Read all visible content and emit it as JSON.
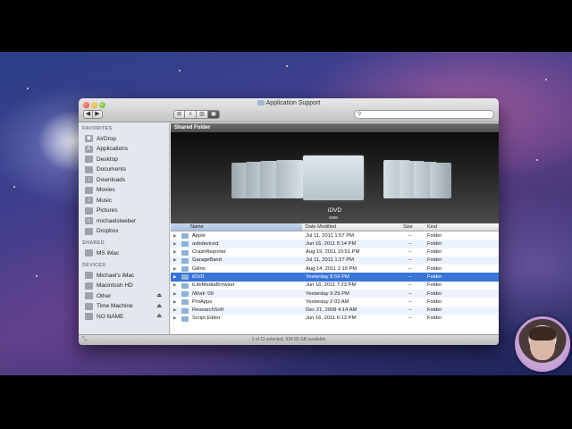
{
  "window": {
    "title": "Application Support",
    "nav": {
      "back": "◀",
      "forward": "▶"
    },
    "view_buttons": [
      "⊞",
      "≡",
      "▥",
      "▣"
    ],
    "search": {
      "placeholder": "",
      "icon": "magnifier-icon"
    }
  },
  "sidebar": {
    "favorites_head": "FAVORITES",
    "favorites": [
      {
        "label": "AirDrop",
        "icon": "airdrop-icon"
      },
      {
        "label": "Applications",
        "icon": "applications-icon"
      },
      {
        "label": "Desktop",
        "icon": "desktop-icon"
      },
      {
        "label": "Documents",
        "icon": "documents-icon"
      },
      {
        "label": "Downloads",
        "icon": "downloads-icon"
      },
      {
        "label": "Movies",
        "icon": "movies-icon"
      },
      {
        "label": "Music",
        "icon": "music-icon"
      },
      {
        "label": "Pictures",
        "icon": "pictures-icon"
      },
      {
        "label": "michaelsteeber",
        "icon": "home-icon"
      },
      {
        "label": "Dropbox",
        "icon": "dropbox-icon"
      }
    ],
    "shared_head": "SHARED",
    "shared": [
      {
        "label": "MS iMac",
        "icon": "computer-icon"
      }
    ],
    "devices_head": "DEVICES",
    "devices": [
      {
        "label": "Michael's iMac",
        "icon": "imac-icon",
        "eject": false
      },
      {
        "label": "Macintosh HD",
        "icon": "hard-drive-icon",
        "eject": false
      },
      {
        "label": "Other",
        "icon": "drive-icon",
        "eject": true
      },
      {
        "label": "Time Machine",
        "icon": "drive-icon",
        "eject": true
      },
      {
        "label": "NO NAME",
        "icon": "drive-icon",
        "eject": true
      }
    ]
  },
  "content": {
    "shared_folder_label": "Shared Folder",
    "coverflow_selected": "iDVD",
    "columns": {
      "name": "Name",
      "date": "Date Modified",
      "size": "Size",
      "kind": "Kind"
    },
    "rows": [
      {
        "name": "Apple",
        "date": "Jul 11, 2011 1:07 PM",
        "size": "--",
        "kind": "Folder"
      },
      {
        "name": "avbdeviced",
        "date": "Jun 16, 2011 5:14 PM",
        "size": "--",
        "kind": "Folder"
      },
      {
        "name": "CrashReporter",
        "date": "Aug 19, 2011 10:51 PM",
        "size": "--",
        "kind": "Folder"
      },
      {
        "name": "GarageBand",
        "date": "Jul 11, 2011 1:27 PM",
        "size": "--",
        "kind": "Folder"
      },
      {
        "name": "Glims",
        "date": "Aug 14, 2011 1:16 PM",
        "size": "--",
        "kind": "Folder"
      },
      {
        "name": "iDVD",
        "date": "Yesterday 8:59 PM",
        "size": "--",
        "kind": "Folder",
        "selected": true
      },
      {
        "name": "iLifeMediaBrowser",
        "date": "Jun 16, 2011 7:23 PM",
        "size": "--",
        "kind": "Folder"
      },
      {
        "name": "iWork '09",
        "date": "Yesterday 9:29 PM",
        "size": "--",
        "kind": "Folder"
      },
      {
        "name": "ProApps",
        "date": "Yesterday 2:03 AM",
        "size": "--",
        "kind": "Folder"
      },
      {
        "name": "ResearchSoft",
        "date": "Dec 21, 2008 4:14 AM",
        "size": "--",
        "kind": "Folder"
      },
      {
        "name": "Script Editor",
        "date": "Jun 16, 2011 6:13 PM",
        "size": "--",
        "kind": "Folder"
      }
    ]
  },
  "statusbar": {
    "text": "1 of 11 selected, 934.65 GB available"
  }
}
